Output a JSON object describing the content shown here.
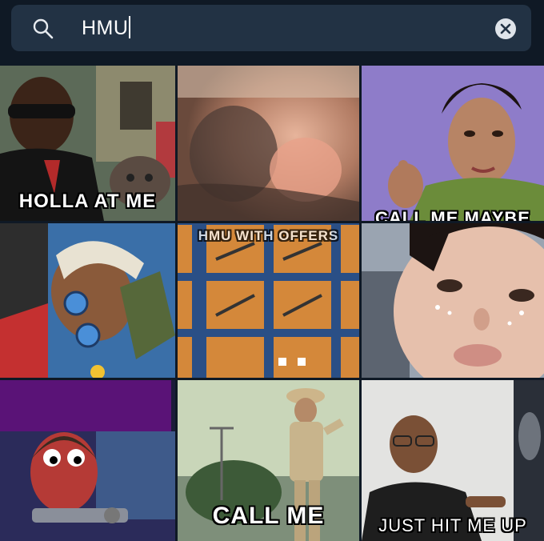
{
  "search": {
    "query": "HMU"
  },
  "gifs": [
    {
      "caption": "HOLLA AT ME"
    },
    {
      "caption": ""
    },
    {
      "caption": "CALL ME MAYBE"
    },
    {
      "caption": ""
    },
    {
      "caption": "HMU WITH OFFERS"
    },
    {
      "caption": ""
    },
    {
      "caption": ""
    },
    {
      "caption": "CALL ME"
    },
    {
      "caption": "JUST HIT ME UP"
    }
  ]
}
